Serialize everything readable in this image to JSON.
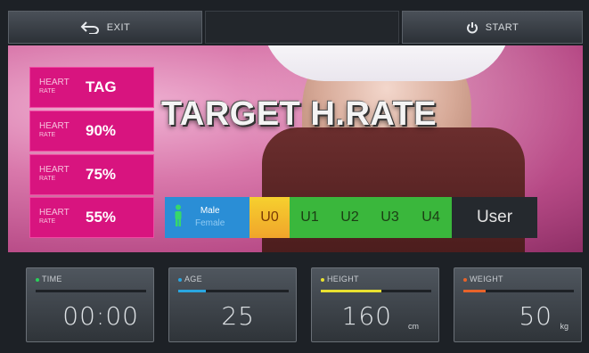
{
  "topbar": {
    "exit_label": "EXIT",
    "start_label": "START"
  },
  "hero": {
    "title": "TARGET H.RATE"
  },
  "heart_buttons": [
    {
      "label_line1": "HEART",
      "label_line2": "RATE",
      "value": "TAG"
    },
    {
      "label_line1": "HEART",
      "label_line2": "RATE",
      "value": "90%"
    },
    {
      "label_line1": "HEART",
      "label_line2": "RATE",
      "value": "75%"
    },
    {
      "label_line1": "HEART",
      "label_line2": "RATE",
      "value": "55%"
    }
  ],
  "gender": {
    "male_label": "Male",
    "female_label": "Female"
  },
  "users": [
    "U0",
    "U1",
    "U2",
    "U3",
    "U4"
  ],
  "user_label": "User",
  "stats": {
    "time": {
      "label": "TIME",
      "value": "00:00",
      "level": 0,
      "color": "#2ad15a"
    },
    "age": {
      "label": "AGE",
      "value": "25",
      "level": 0.25,
      "color": "#2aa6e0"
    },
    "height": {
      "label": "HEIGHT",
      "value": "160",
      "unit": "cm",
      "level": 0.55,
      "color": "#e8e030"
    },
    "weight": {
      "label": "WEIGHT",
      "value": "50",
      "unit": "kg",
      "level": 0.2,
      "color": "#e8632a"
    }
  },
  "icons": {
    "exit": "back-arrow-icon",
    "start": "power-icon",
    "gender": "person-icon"
  }
}
